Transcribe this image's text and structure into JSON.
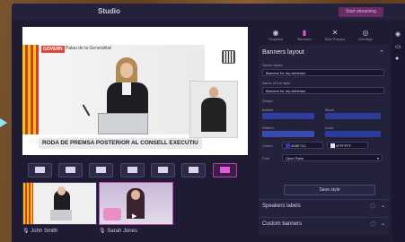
{
  "app": {
    "title": "Studio",
    "start_label": "Start streaming"
  },
  "stage": {
    "brand": "GOVERN",
    "org": "Palau de la Generalitat",
    "banner_text": "RODA DE PREMSA POSTERIOR AL CONSELL EXECUTIU"
  },
  "layouts": [
    {
      "name": "layout-solo"
    },
    {
      "name": "layout-cropped"
    },
    {
      "name": "layout-group"
    },
    {
      "name": "layout-spotlight"
    },
    {
      "name": "layout-news"
    },
    {
      "name": "layout-screen"
    },
    {
      "name": "layout-pip",
      "active": true
    }
  ],
  "participants": [
    {
      "name": "John Smith",
      "icon": "mic-icon"
    },
    {
      "name": "Sarah Jones",
      "icon": "mic-icon"
    }
  ],
  "panel": {
    "tabs": [
      {
        "label": "Graphics",
        "icon": "palette-icon"
      },
      {
        "label": "Banners",
        "icon": "bookmark-icon",
        "active": true
      },
      {
        "label": "Side Popups",
        "icon": "close-icon"
      },
      {
        "label": "Overlays",
        "icon": "broadcast-icon"
      }
    ],
    "section_title": "Banners layout",
    "saved_styles_label": "Saved styles",
    "saved_styles_value": "Banners for my webinars",
    "name_label": "Name of the style",
    "name_value": "Banners for my webinars",
    "shape_label": "Shape",
    "styles": [
      {
        "label": "Bubble",
        "color": "#2f3fa0"
      },
      {
        "label": "Block",
        "color": "#2c3c9c"
      },
      {
        "label": "Ribbon",
        "color": "#3a4bb0"
      },
      {
        "label": "Invite",
        "color": "#2c3c9c"
      }
    ],
    "colors_label": "Colors",
    "color_primary": "#28E71C",
    "color_secondary": "#FFFFFF",
    "color_primary_swatch": "#2f3aa8",
    "color_secondary_swatch": "#e8e6ee",
    "font_label": "Font",
    "font_value": "Open Sans",
    "save_label": "Save style",
    "speakers_label": "Speakers labels",
    "custom_label": "Custom banners"
  }
}
